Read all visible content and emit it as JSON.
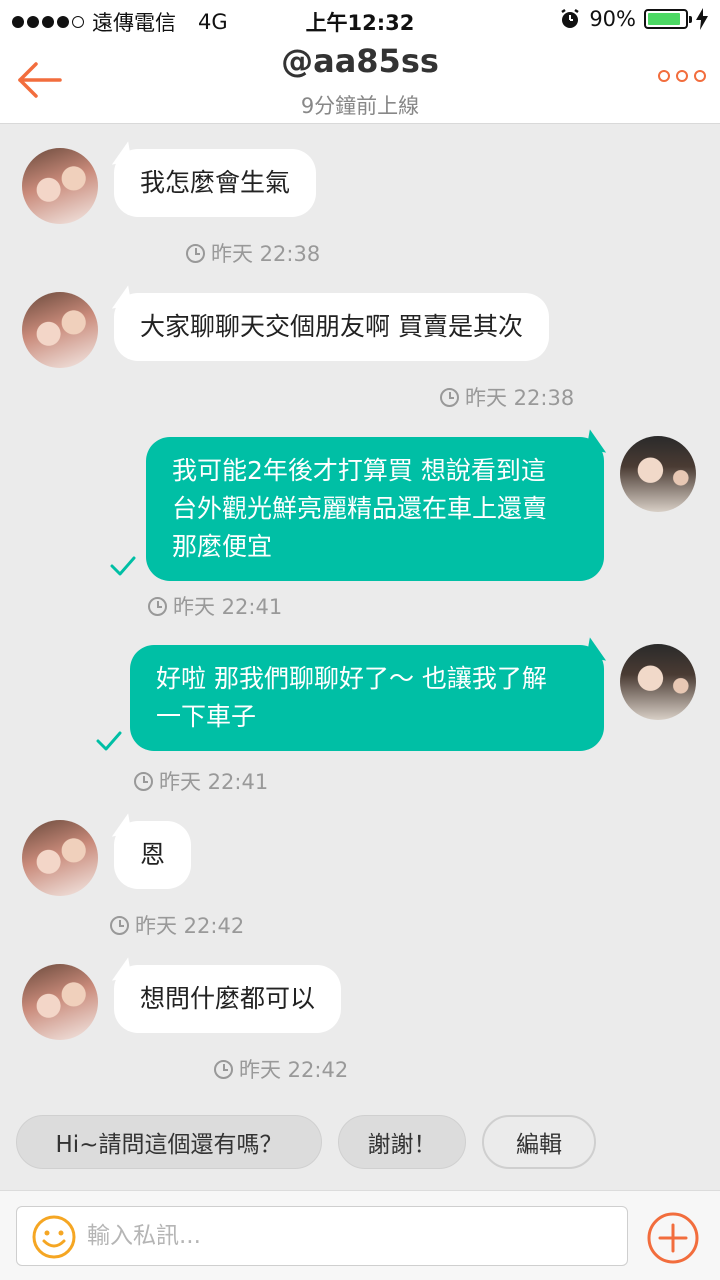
{
  "status_bar": {
    "carrier": "遠傳電信",
    "network": "4G",
    "time": "上午12:32",
    "battery": "90%",
    "battery_level": 0.9
  },
  "header": {
    "title": "@aa85ss",
    "subtitle": "9分鐘前上線",
    "back_icon": "back-arrow-icon",
    "more_icon": "more-dots-icon"
  },
  "messages": [
    {
      "direction": "in",
      "text": "我怎麼會生氣",
      "time": "昨天 22:38"
    },
    {
      "direction": "in",
      "text": "大家聊聊天交個朋友啊 買賣是其次",
      "time": "昨天 22:38"
    },
    {
      "direction": "out",
      "lines": [
        "我可能2年後才打算買 想說看到這",
        "台外觀光鮮亮麗精品還在車上還賣",
        "那麼便宜"
      ],
      "time": "昨天 22:41",
      "read": true
    },
    {
      "direction": "out",
      "lines": [
        "好啦 那我們聊聊好了～ 也讓我了解",
        "一下車子"
      ],
      "time": "昨天 22:41",
      "read": true
    },
    {
      "direction": "in",
      "text": "恩",
      "time": "昨天 22:42"
    },
    {
      "direction": "in",
      "text": "想問什麼都可以",
      "time": "昨天 22:42"
    }
  ],
  "quick_replies": [
    {
      "label": "Hi~請問這個還有嗎？"
    },
    {
      "label": "謝謝！"
    },
    {
      "label": "編輯"
    }
  ],
  "composer": {
    "placeholder": "輸入私訊...",
    "value": ""
  },
  "colors": {
    "accent": "#f26d3d",
    "outgoing_bubble": "#00bfa5",
    "background": "#ebebeb"
  }
}
